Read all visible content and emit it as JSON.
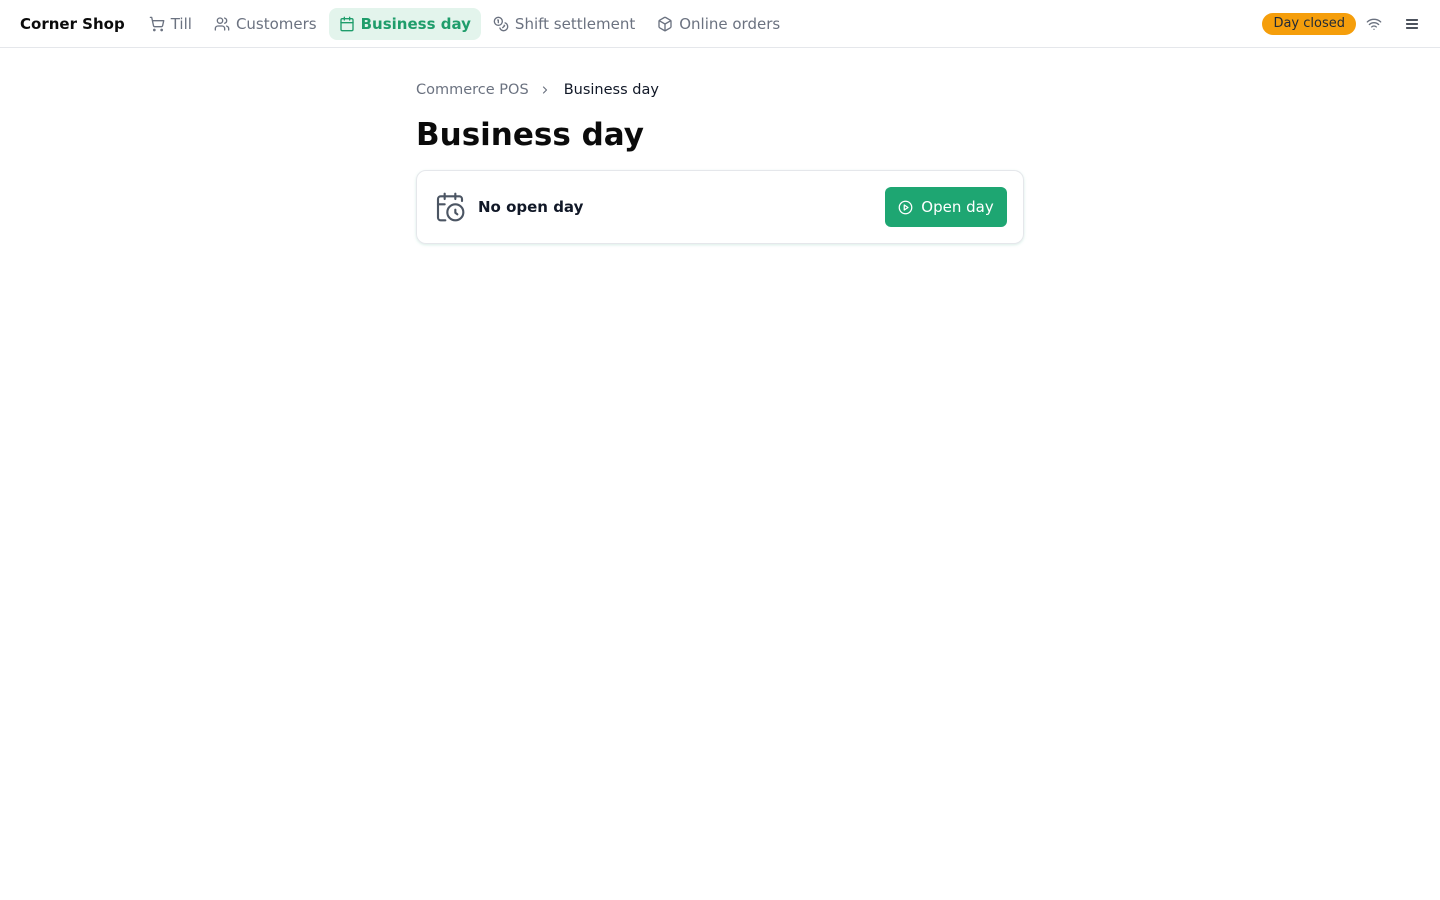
{
  "app": {
    "brand": "Corner Shop"
  },
  "nav": {
    "items": [
      {
        "label": "Till",
        "icon": "cart-icon",
        "active": false
      },
      {
        "label": "Customers",
        "icon": "users-icon",
        "active": false
      },
      {
        "label": "Business day",
        "icon": "calendar-icon",
        "active": true
      },
      {
        "label": "Shift settlement",
        "icon": "coins-icon",
        "active": false
      },
      {
        "label": "Online orders",
        "icon": "package-icon",
        "active": false
      }
    ]
  },
  "status": {
    "label": "Day closed",
    "color": "#f59e0b"
  },
  "breadcrumb": {
    "root": "Commerce POS",
    "current": "Business day"
  },
  "page": {
    "title": "Business day"
  },
  "day_card": {
    "icon": "calendar-clock-icon",
    "title": "No open day",
    "button_label": "Open day",
    "button_icon": "play-circle-icon"
  },
  "colors": {
    "accent": "#1ea672",
    "active_nav_bg": "#e3f4ec",
    "status_badge": "#f59e0b"
  }
}
